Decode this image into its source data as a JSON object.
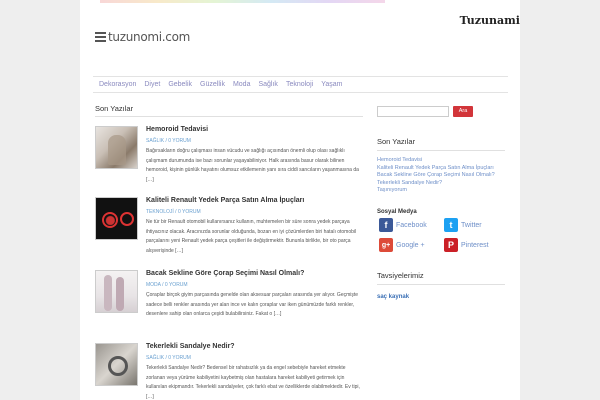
{
  "site": {
    "logo_text": "tuzunomi.com",
    "title": "Tuzunami"
  },
  "nav": [
    "Dekorasyon",
    "Diyet",
    "Gebelik",
    "Güzellik",
    "Moda",
    "Sağlık",
    "Teknoloji",
    "Yaşam"
  ],
  "main": {
    "section_title": "Son Yazılar",
    "posts": [
      {
        "title": "Hemoroid Tedavisi",
        "meta": "SAĞLIK / 0 YORUM",
        "excerpt": "Bağırsakların doğru çalışması insan vücudu ve sağlığı açısından önemli olup olası sağlıklı çalışmam durumunda ise bazı sorunlar yaşayabiliniyor. Halk arasında basur olarak bilinen hemoroid, kişinin günlük hayatını olumsuz etkilemenin yanı sıra ciddi sancıların yaşanmasına da […]"
      },
      {
        "title": "Kaliteli Renault Yedek Parça Satın Alma İpuçları",
        "meta": "TEKNOLOJİ / 0 YORUM",
        "excerpt": "Ne tür bir Renault otomobil kullanırsanız kullanın, muhtemelen bir süre sonra yedek parçaya ihtiyacınız olacak. Aracınızda sorunlar olduğunda, bozan en iyi çözümlerden biri hatalı otomobil parçalarını yeni Renault yedek parça çeşitleri ile değiştirmektir. Bununla birlikte, bir oto parça alışverişinde […]"
      },
      {
        "title": "Bacak Sekline Göre Çorap Seçimi Nasıl Olmalı?",
        "meta": "MODA / 0 YORUM",
        "excerpt": "Çoraplar birçok giyim parçasında genelde olan aksesuar parçaları arasında yer alıyor. Geçmişte sadece belli renkler arasında yer alan ince ve kalın çoraplar var iken günümüzde farklı renkler, desenlere sahip olan onlarca çeşidi bulabilirsiniz. Fakat o […]"
      },
      {
        "title": "Tekerlekli Sandalye Nedir?",
        "meta": "SAĞLIK / 0 YORUM",
        "excerpt": "Tekerlekli Sandalye Nedir? Bedensel bir rahatsızlık ya da engel sebebiyle hareket etmekte zorlanan veya yürüme kabiliyetini kaybetmiş olan hastalara hareket kabiliyeti getirmek için kullanılan ekipmandır. Tekerlekli sandalyeler, çok farklı ebat ve özelliklerde olabilmektedir. Ev tipi, […]"
      }
    ]
  },
  "sidebar": {
    "search_placeholder": "",
    "search_button": "Ara",
    "recent_title": "Son Yazılar",
    "recent": [
      "Hemoroid Tedavisi",
      "Kaliteli Renault Yedek Parça Satın Alma İpuçları",
      "Bacak Sekline Göre Çorap Seçimi Nasıl Olmalı?",
      "Tekerlekli Sandalye Nedir?",
      "Taşınıyorum"
    ],
    "social_title": "Sosyal Medya",
    "social": [
      {
        "label": "Facebook",
        "icon": "facebook-icon",
        "glyph": "f",
        "color": "#3b5998"
      },
      {
        "label": "Twitter",
        "icon": "twitter-icon",
        "glyph": "t",
        "color": "#1da1f2"
      },
      {
        "label": "Google +",
        "icon": "google-plus-icon",
        "glyph": "g+",
        "color": "#dd4b39"
      },
      {
        "label": "Pinterest",
        "icon": "pinterest-icon",
        "glyph": "P",
        "color": "#cb2027"
      }
    ],
    "recommend_title": "Tavsiyelerimiz",
    "recommend_link": "saç kaynak"
  }
}
